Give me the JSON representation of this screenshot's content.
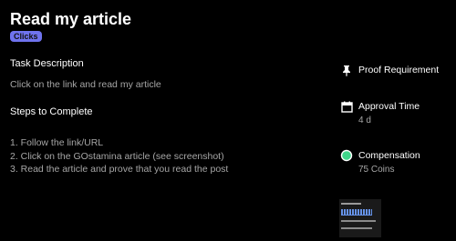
{
  "task": {
    "title": "Read my article",
    "category_badge": "Clicks"
  },
  "description": {
    "heading": "Task Description",
    "text": "Click on the link and read my article"
  },
  "steps": {
    "heading": "Steps to Complete",
    "items": [
      "1. Follow the link/URL",
      "2. Click on the GOstamina article (see screenshot)",
      "3. Read the article and prove that you read the post"
    ]
  },
  "sidebar": {
    "proof": {
      "icon": "pin-icon",
      "label": "Proof Requirement"
    },
    "approval": {
      "icon": "calendar-icon",
      "label": "Approval Time",
      "value": "4 d"
    },
    "compensation": {
      "icon": "coin-icon",
      "label": "Compensation",
      "value": "75 Coins"
    }
  },
  "colors": {
    "background": "#000000",
    "badge": "#6f73ee",
    "coin": "#3fd68a",
    "muted_text": "#a6a6a6"
  }
}
